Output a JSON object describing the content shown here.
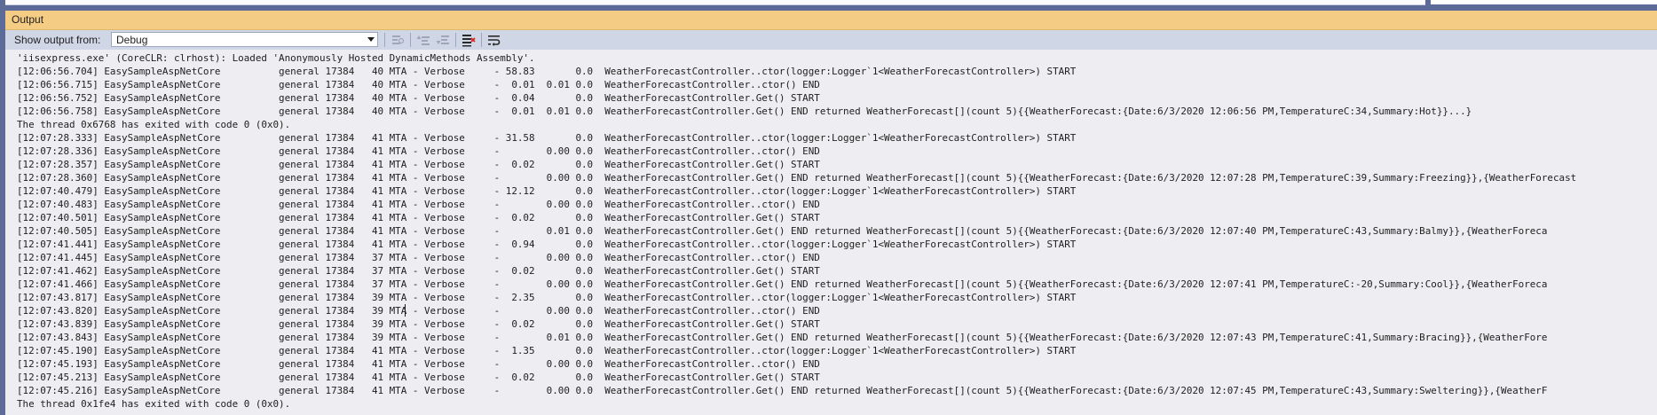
{
  "panel": {
    "title": "Output",
    "show_output_from_label": "Show output from:",
    "source_selected": "Debug"
  },
  "toolbar_icons": [
    "find-message-icon",
    "go-previous-icon",
    "go-next-icon",
    "clear-all-icon",
    "word-wrap-icon"
  ],
  "colors": {
    "title_bar": "#f5cc84",
    "toolbar": "#cfd6e5",
    "log_background": "#eeeef2",
    "frame": "#5d6b99"
  },
  "log_lines": [
    "'iisexpress.exe' (CoreCLR: clrhost): Loaded 'Anonymously Hosted DynamicMethods Assembly'.",
    "[12:06:56.704] EasySampleAspNetCore          general 17384   40 MTA - Verbose     - 58.83       0.0  WeatherForecastController..ctor(logger:Logger`1<WeatherForecastController>) START",
    "[12:06:56.715] EasySampleAspNetCore          general 17384   40 MTA - Verbose     -  0.01  0.01 0.0  WeatherForecastController..ctor() END",
    "[12:06:56.752] EasySampleAspNetCore          general 17384   40 MTA - Verbose     -  0.04       0.0  WeatherForecastController.Get() START",
    "[12:06:56.758] EasySampleAspNetCore          general 17384   40 MTA - Verbose     -  0.01  0.01 0.0  WeatherForecastController.Get() END returned WeatherForecast[](count 5){{WeatherForecast:{Date:6/3/2020 12:06:56 PM,TemperatureC:34,Summary:Hot}}...}",
    "The thread 0x6768 has exited with code 0 (0x0).",
    "[12:07:28.333] EasySampleAspNetCore          general 17384   41 MTA - Verbose     - 31.58       0.0  WeatherForecastController..ctor(logger:Logger`1<WeatherForecastController>) START",
    "[12:07:28.336] EasySampleAspNetCore          general 17384   41 MTA - Verbose     -        0.00 0.0  WeatherForecastController..ctor() END",
    "[12:07:28.357] EasySampleAspNetCore          general 17384   41 MTA - Verbose     -  0.02       0.0  WeatherForecastController.Get() START",
    "[12:07:28.360] EasySampleAspNetCore          general 17384   41 MTA - Verbose     -        0.00 0.0  WeatherForecastController.Get() END returned WeatherForecast[](count 5){{WeatherForecast:{Date:6/3/2020 12:07:28 PM,TemperatureC:39,Summary:Freezing}},{WeatherForecast",
    "[12:07:40.479] EasySampleAspNetCore          general 17384   41 MTA - Verbose     - 12.12       0.0  WeatherForecastController..ctor(logger:Logger`1<WeatherForecastController>) START",
    "[12:07:40.483] EasySampleAspNetCore          general 17384   41 MTA - Verbose     -        0.00 0.0  WeatherForecastController..ctor() END",
    "[12:07:40.501] EasySampleAspNetCore          general 17384   41 MTA - Verbose     -  0.02       0.0  WeatherForecastController.Get() START",
    "[12:07:40.505] EasySampleAspNetCore          general 17384   41 MTA - Verbose     -        0.01 0.0  WeatherForecastController.Get() END returned WeatherForecast[](count 5){{WeatherForecast:{Date:6/3/2020 12:07:40 PM,TemperatureC:43,Summary:Balmy}},{WeatherForeca",
    "[12:07:41.441] EasySampleAspNetCore          general 17384   41 MTA - Verbose     -  0.94       0.0  WeatherForecastController..ctor(logger:Logger`1<WeatherForecastController>) START",
    "[12:07:41.445] EasySampleAspNetCore          general 17384   37 MTA - Verbose     -        0.00 0.0  WeatherForecastController..ctor() END",
    "[12:07:41.462] EasySampleAspNetCore          general 17384   37 MTA - Verbose     -  0.02       0.0  WeatherForecastController.Get() START",
    "[12:07:41.466] EasySampleAspNetCore          general 17384   37 MTA - Verbose     -        0.00 0.0  WeatherForecastController.Get() END returned WeatherForecast[](count 5){{WeatherForecast:{Date:6/3/2020 12:07:41 PM,TemperatureC:-20,Summary:Cool}},{WeatherForeca",
    "[12:07:43.817] EasySampleAspNetCore          general 17384   39 MTA - Verbose     -  2.35       0.0  WeatherForecastController..ctor(logger:Logger`1<WeatherForecastController>) START",
    "[12:07:43.820] EasySampleAspNetCore          general 17384   39 MTA - Verbose     -        0.00 0.0  WeatherForecastController..ctor() END",
    "[12:07:43.839] EasySampleAspNetCore          general 17384   39 MTA - Verbose     -  0.02       0.0  WeatherForecastController.Get() START",
    "[12:07:43.843] EasySampleAspNetCore          general 17384   39 MTA - Verbose     -        0.01 0.0  WeatherForecastController.Get() END returned WeatherForecast[](count 5){{WeatherForecast:{Date:6/3/2020 12:07:43 PM,TemperatureC:41,Summary:Bracing}},{WeatherFore",
    "[12:07:45.190] EasySampleAspNetCore          general 17384   41 MTA - Verbose     -  1.35       0.0  WeatherForecastController..ctor(logger:Logger`1<WeatherForecastController>) START",
    "[12:07:45.193] EasySampleAspNetCore          general 17384   41 MTA - Verbose     -        0.00 0.0  WeatherForecastController..ctor() END",
    "[12:07:45.213] EasySampleAspNetCore          general 17384   41 MTA - Verbose     -  0.02       0.0  WeatherForecastController.Get() START",
    "[12:07:45.216] EasySampleAspNetCore          general 17384   41 MTA - Verbose     -        0.00 0.0  WeatherForecastController.Get() END returned WeatherForecast[](count 5){{WeatherForecast:{Date:6/3/2020 12:07:45 PM,TemperatureC:43,Summary:Sweltering}},{WeatherF",
    "The thread 0x1fe4 has exited with code 0 (0x0)."
  ]
}
